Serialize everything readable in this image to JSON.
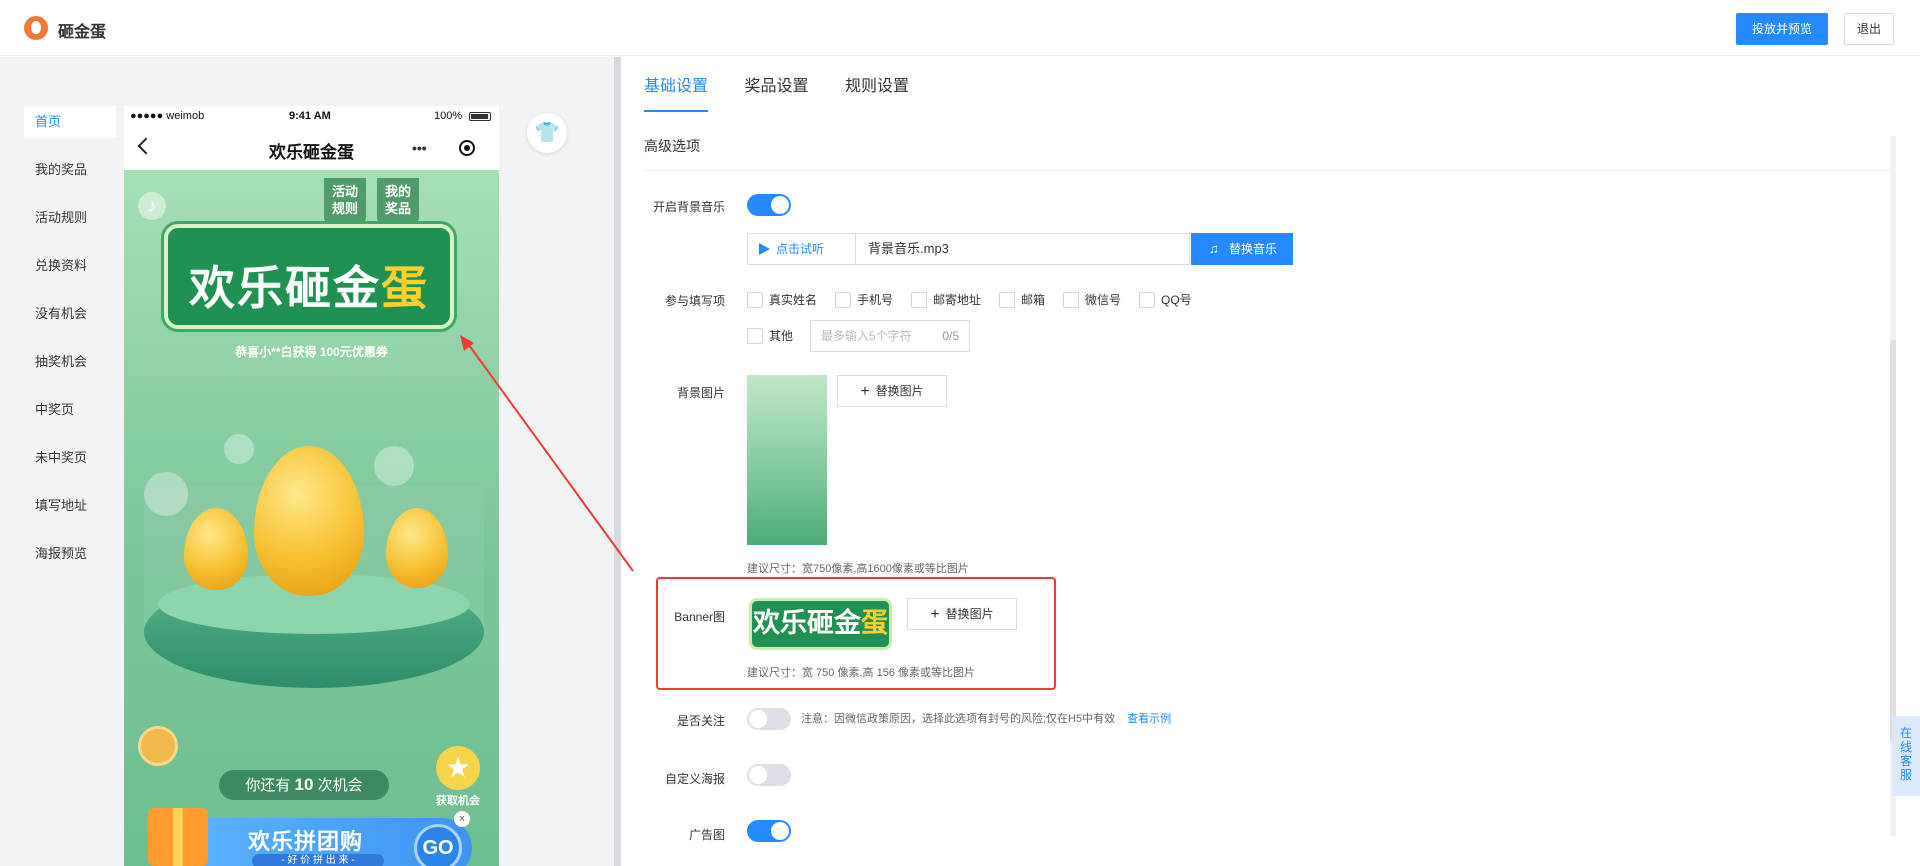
{
  "app": {
    "title": "砸金蛋",
    "logo_icon": "egg-logo-icon"
  },
  "header": {
    "publish_label": "投放并预览",
    "exit_label": "退出"
  },
  "sidebar": {
    "items": [
      {
        "label": "首页",
        "active": true
      },
      {
        "label": "我的奖品"
      },
      {
        "label": "活动规则"
      },
      {
        "label": "兑换资料"
      },
      {
        "label": "没有机会"
      },
      {
        "label": "抽奖机会"
      },
      {
        "label": "中奖页"
      },
      {
        "label": "未中奖页"
      },
      {
        "label": "填写地址"
      },
      {
        "label": "海报预览"
      }
    ]
  },
  "phone": {
    "status": {
      "carrier": "●●●●● weimob",
      "time": "9:41 AM",
      "battery": "100%"
    },
    "nav_title": "欢乐砸金蛋",
    "nav_dots": "•••",
    "rules_btn": "活动\n规则",
    "prizes_btn": "我的\n奖品",
    "banner_text_main": "欢乐砸金",
    "banner_text_gold": "蛋",
    "winner_text": "恭喜小**白获得 100元优惠券",
    "chances_prefix": "你还有 ",
    "chances_count": "10",
    "chances_suffix": " 次机会",
    "get_chance_label": "获取机会",
    "group_buy_title": "欢乐拼团购",
    "group_buy_sub": "- 好 价 拼 出 来 -",
    "go_label": "GO",
    "close_label": "×"
  },
  "tabs": [
    {
      "label": "基础设置",
      "active": true
    },
    {
      "label": "奖品设置"
    },
    {
      "label": "规则设置"
    }
  ],
  "section_title": "高级选项",
  "music": {
    "label": "开启背景音乐",
    "enabled": true,
    "play_label": "点击试听",
    "file_name": "背景音乐.mp3",
    "replace_label": "替换音乐"
  },
  "fields": {
    "label": "参与填写项",
    "options": [
      "真实姓名",
      "手机号",
      "邮寄地址",
      "邮箱",
      "微信号",
      "QQ号"
    ],
    "other_label": "其他",
    "other_placeholder": "最多输入5个字符",
    "other_count": "0/5"
  },
  "bg_image": {
    "label": "背景图片",
    "replace_label": "替换图片",
    "hint": "建议尺寸：宽750像素,高1600像素或等比图片"
  },
  "banner_image": {
    "label": "Banner图",
    "thumb_main": "欢乐砸金",
    "thumb_gold": "蛋",
    "replace_label": "替换图片",
    "hint": "建议尺寸：宽 750 像素,高 156 像素或等比图片"
  },
  "follow": {
    "label": "是否关注",
    "enabled": false,
    "notice": "注意：因微信政策原因，选择此选项有封号的风险;仅在H5中有效",
    "link": "查看示例"
  },
  "poster": {
    "label": "自定义海报",
    "enabled": false
  },
  "ad": {
    "label": "广告图",
    "enabled": true
  },
  "float_service": "在\n线\n客\n服",
  "colors": {
    "accent": "#2589ff",
    "highlight_box": "#f03a34",
    "brand": "#f27a35"
  }
}
